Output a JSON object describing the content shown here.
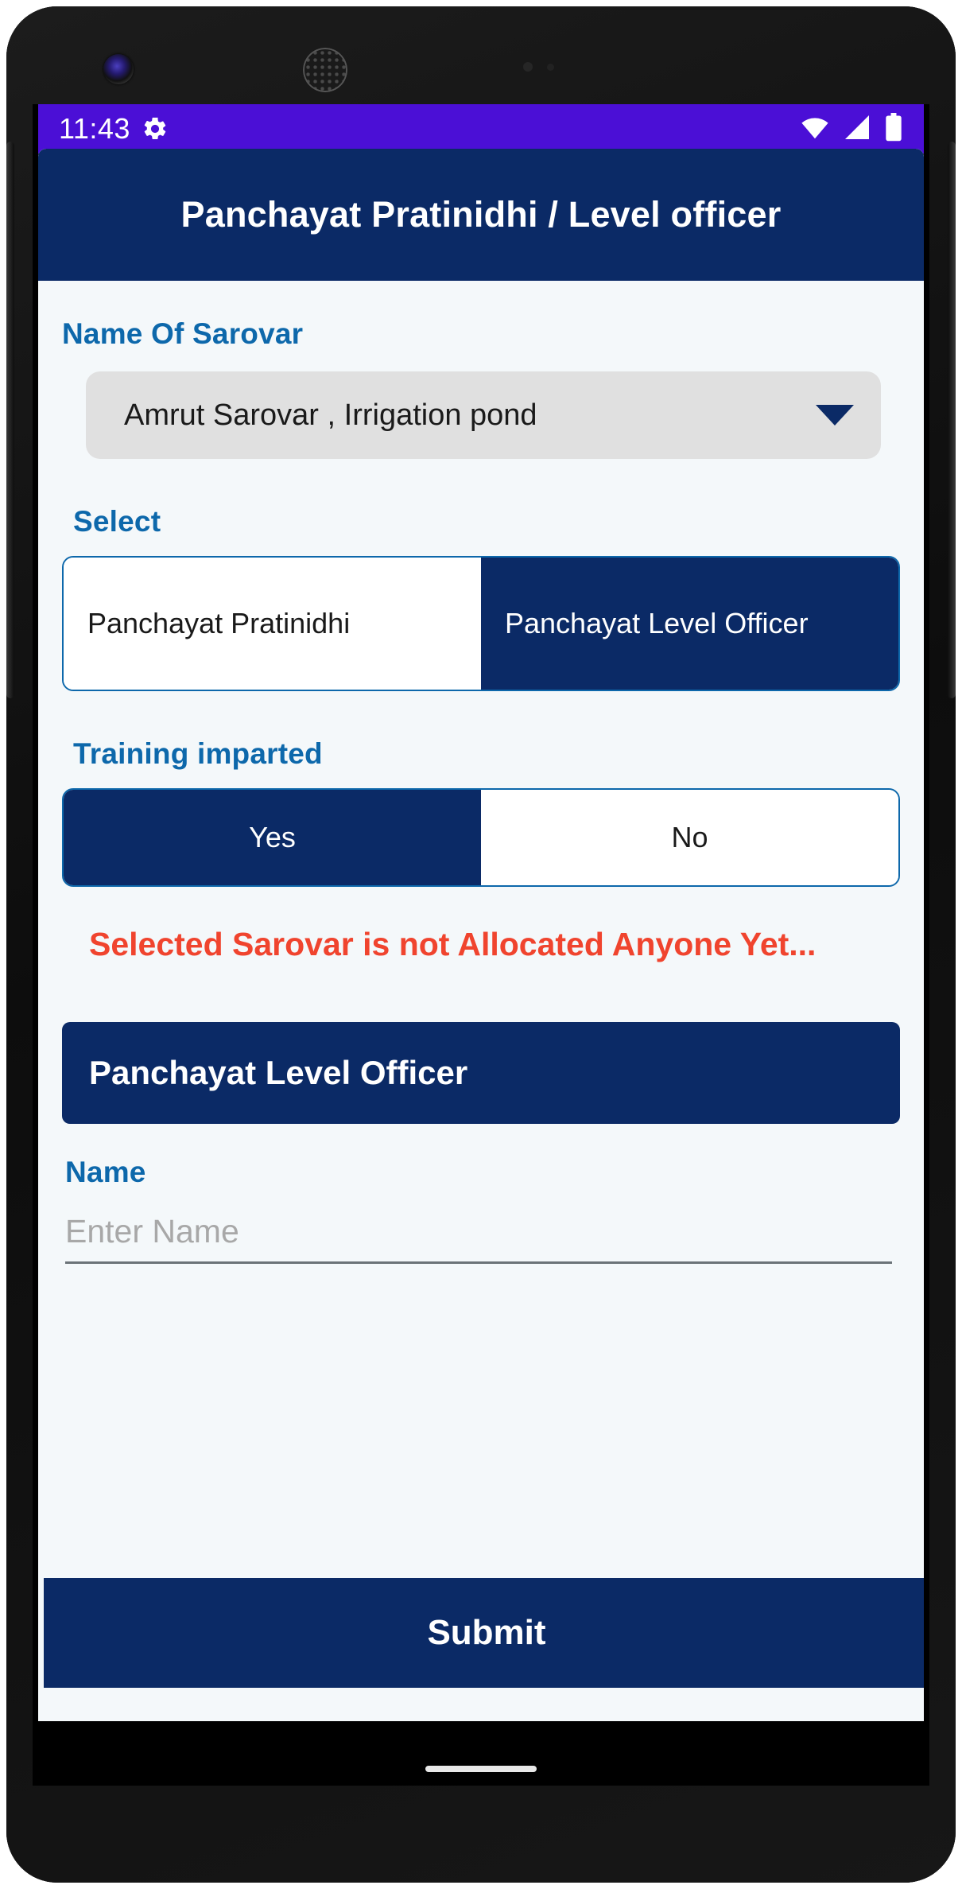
{
  "status_bar": {
    "time": "11:43",
    "gear_icon": "gear-icon",
    "wifi_icon": "wifi-icon",
    "signal_icon": "cellular-signal-icon",
    "battery_icon": "battery-icon",
    "background_color": "#4b0fd6"
  },
  "app_bar": {
    "title": "Panchayat Pratinidhi / Level officer",
    "background_color": "#0b2a66"
  },
  "form": {
    "sarovar": {
      "label": "Name Of Sarovar",
      "selected_value": "Amrut Sarovar , Irrigation pond",
      "caret_icon": "chevron-down-icon"
    },
    "select": {
      "label": "Select",
      "options": [
        {
          "label": "Panchayat Pratinidhi",
          "selected": false
        },
        {
          "label": "Panchayat Level Officer",
          "selected": true
        }
      ]
    },
    "training": {
      "label": "Training imparted",
      "options": [
        {
          "label": "Yes",
          "selected": true
        },
        {
          "label": "No",
          "selected": false
        }
      ]
    },
    "alert": {
      "message": "Selected   Sarovar is not Allocated Anyone Yet...",
      "color": "#f0442e"
    },
    "officer_section": {
      "banner_title": "Panchayat Level Officer"
    },
    "name": {
      "label": "Name",
      "value": "",
      "placeholder": "Enter Name"
    },
    "submit": {
      "label": "Submit"
    }
  },
  "theme": {
    "primary_navy": "#0b2a66",
    "label_blue": "#0d68ab",
    "page_background": "#f4f8fa",
    "status_purple": "#4b0fd6"
  }
}
